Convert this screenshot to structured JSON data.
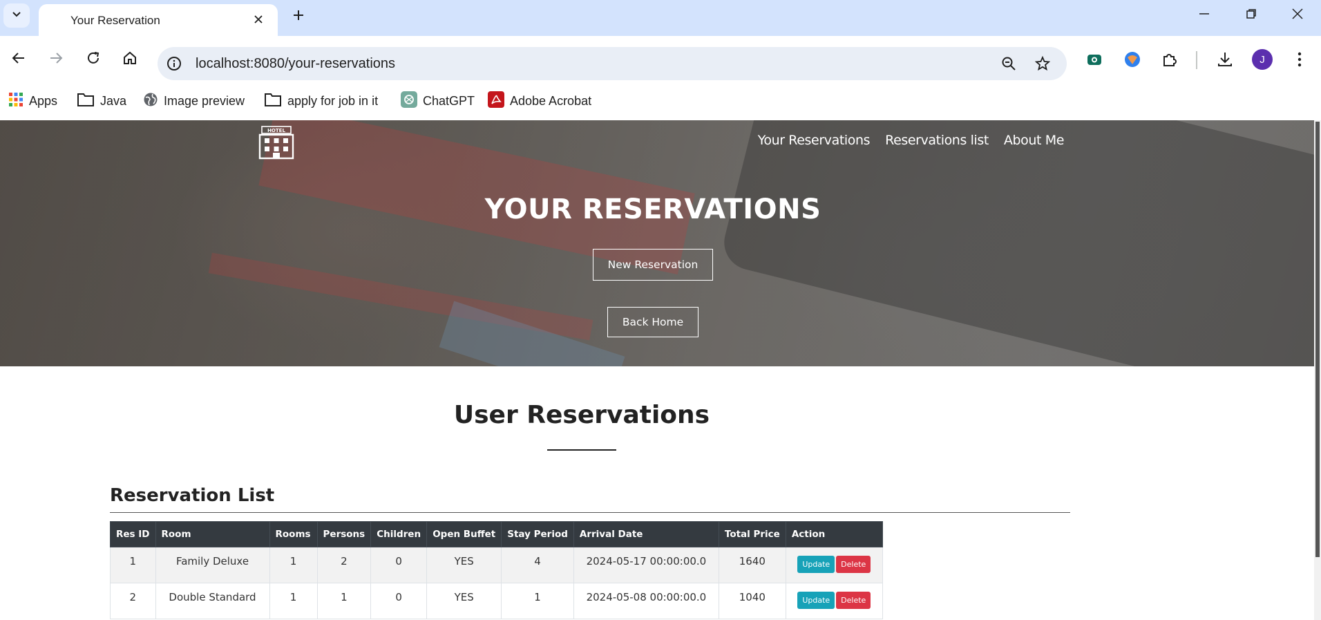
{
  "browser": {
    "tab_title": "Your Reservation",
    "url": "localhost:8080/your-reservations",
    "profile_initial": "J",
    "bookmarks": [
      {
        "label": "Apps",
        "icon": "apps-grid-icon"
      },
      {
        "label": "Java",
        "icon": "folder-icon"
      },
      {
        "label": "Image preview",
        "icon": "globe-icon"
      },
      {
        "label": "apply for job in it",
        "icon": "folder-icon"
      },
      {
        "label": "ChatGPT",
        "icon": "chatgpt-icon"
      },
      {
        "label": "Adobe Acrobat",
        "icon": "acrobat-icon"
      }
    ]
  },
  "site": {
    "logo_text": "HOTEL",
    "nav": [
      "Your Reservations",
      "Reservations list",
      "About Me"
    ],
    "hero_title": "YOUR RESERVATIONS",
    "new_reservation_label": "New Reservation",
    "back_home_label": "Back Home"
  },
  "content": {
    "section_title": "User Reservations",
    "list_title": "Reservation List",
    "columns": [
      "Res ID",
      "Room",
      "Rooms",
      "Persons",
      "Children",
      "Open Buffet",
      "Stay Period",
      "Arrival Date",
      "Total Price",
      "Action"
    ],
    "rows": [
      {
        "id": "1",
        "room": "Family Deluxe",
        "rooms": "1",
        "persons": "2",
        "children": "0",
        "buffet": "YES",
        "stay": "4",
        "arrival": "2024-05-17 00:00:00.0",
        "price": "1640"
      },
      {
        "id": "2",
        "room": "Double Standard",
        "rooms": "1",
        "persons": "1",
        "children": "0",
        "buffet": "YES",
        "stay": "1",
        "arrival": "2024-05-08 00:00:00.0",
        "price": "1040"
      }
    ],
    "update_label": "Update",
    "delete_label": "Delete"
  },
  "colors": {
    "tabstrip": "#d3e3fd",
    "table_header": "#343a40",
    "update_button": "#17a2b8",
    "delete_button": "#dc3545"
  }
}
